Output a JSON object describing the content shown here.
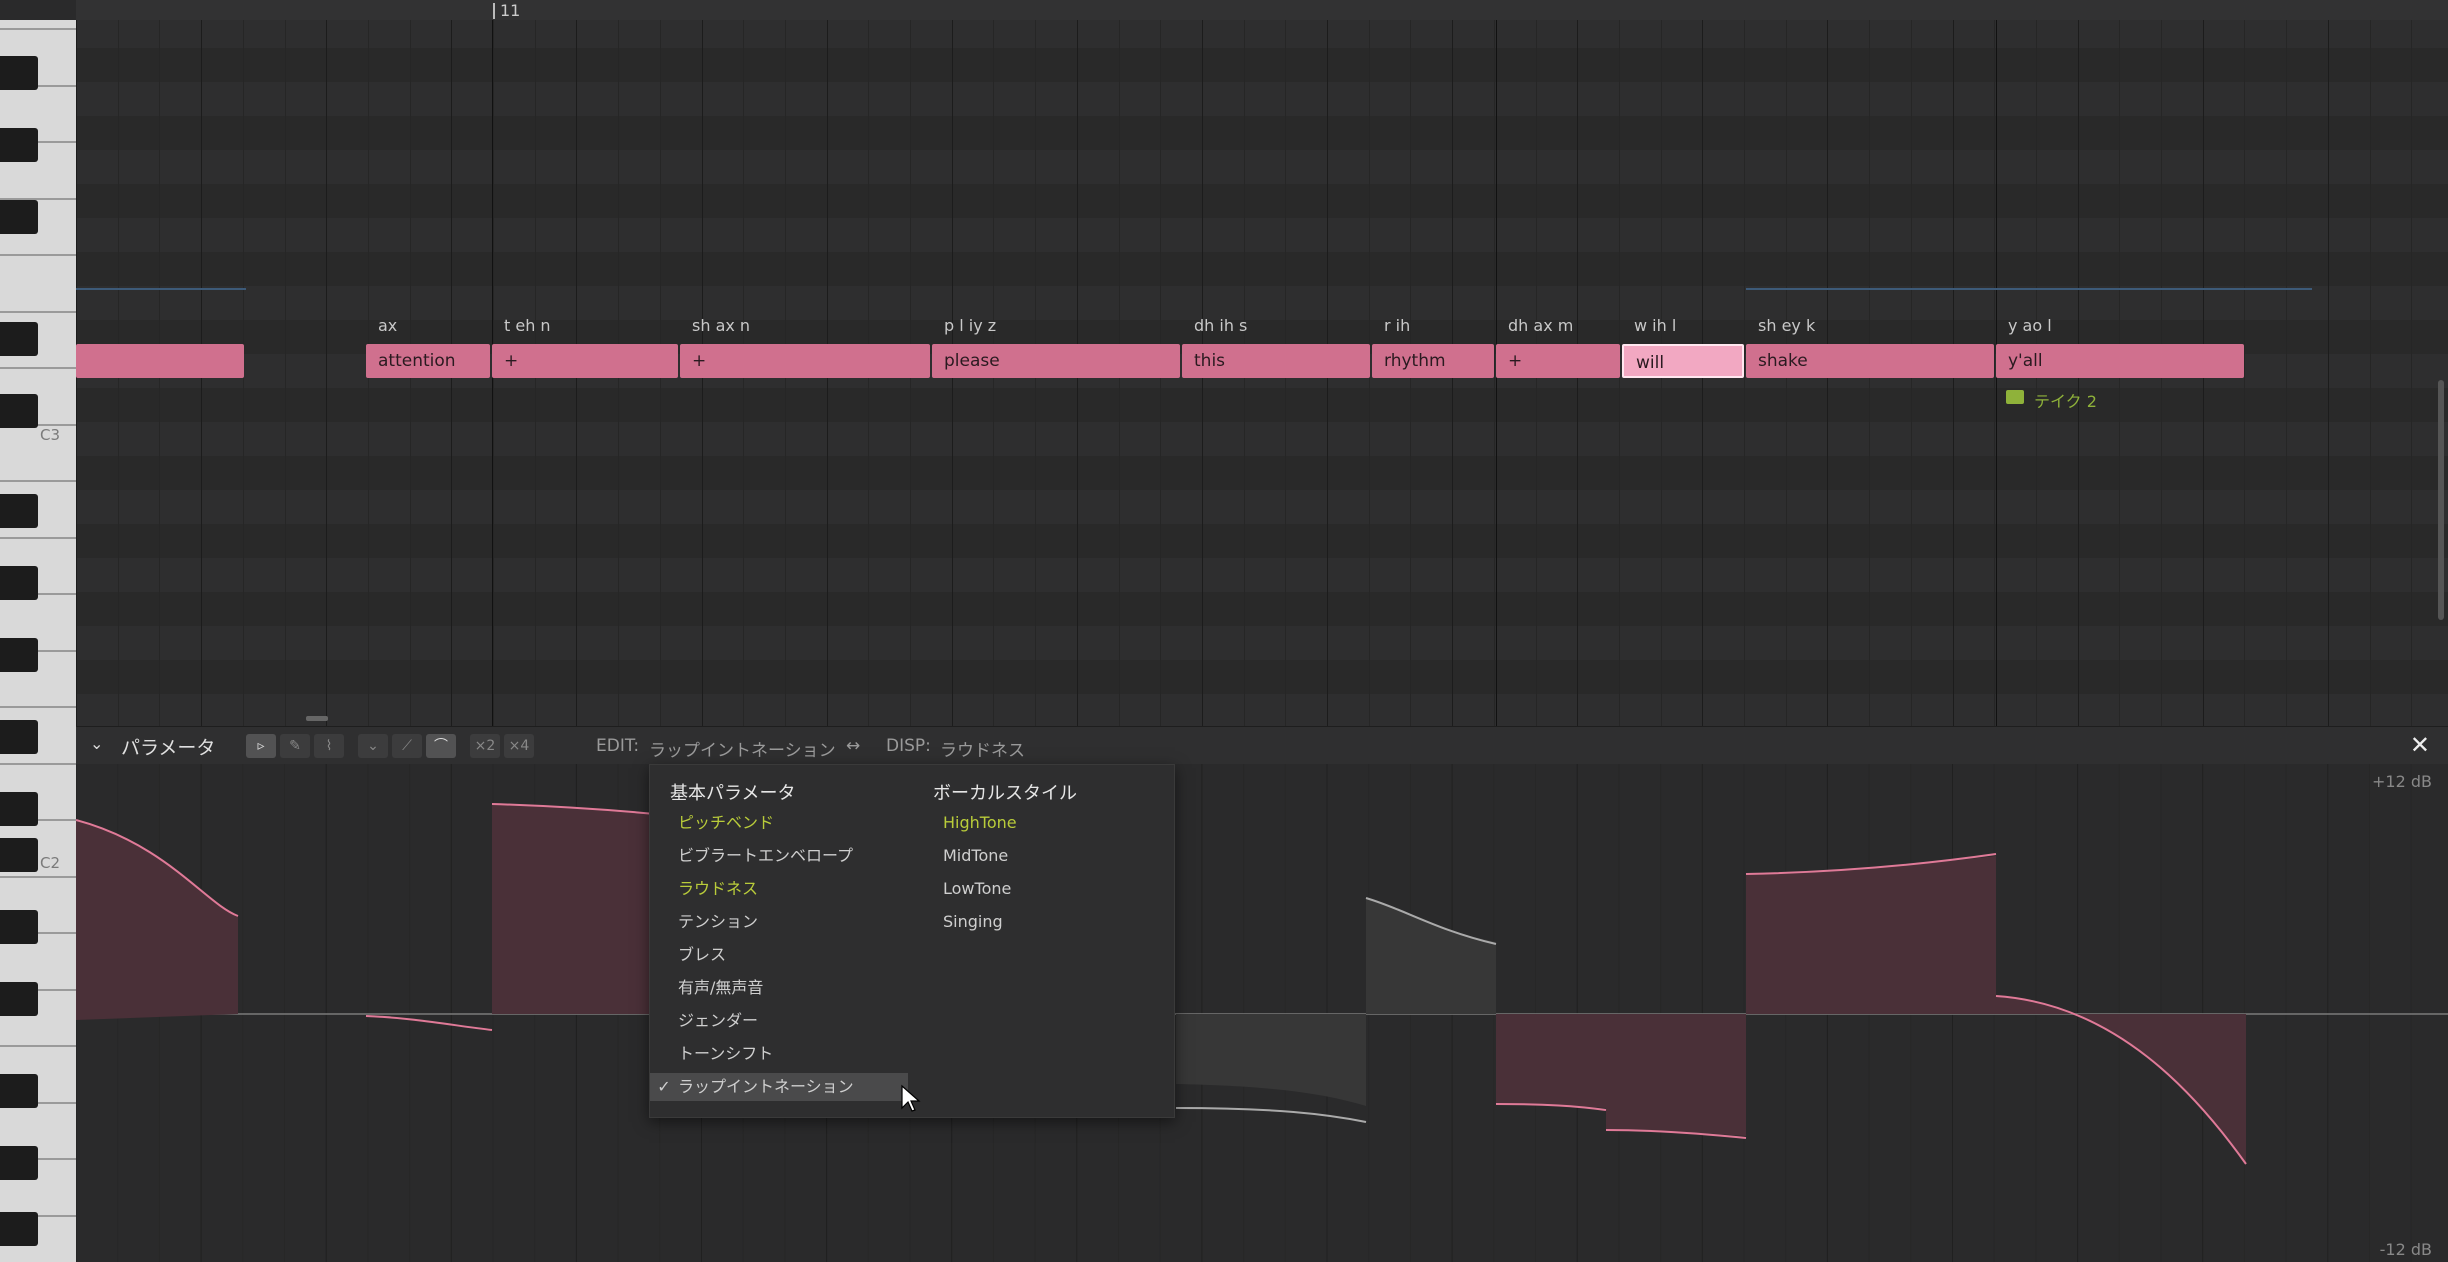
{
  "ruler": {
    "bar_number": "11"
  },
  "piano": {
    "label_c3": "C3",
    "label_c2": "C2"
  },
  "notes": [
    {
      "lyric": "",
      "phoneme": ""
    },
    {
      "lyric": "attention",
      "phoneme": "ax"
    },
    {
      "lyric": "+",
      "phoneme": "t eh n"
    },
    {
      "lyric": "+",
      "phoneme": "sh ax n"
    },
    {
      "lyric": "please",
      "phoneme": "p l iy z"
    },
    {
      "lyric": "this",
      "phoneme": "dh ih s"
    },
    {
      "lyric": "rhythm",
      "phoneme": "r ih"
    },
    {
      "lyric": "+",
      "phoneme": "dh ax m"
    },
    {
      "lyric": "will",
      "phoneme": "w ih l"
    },
    {
      "lyric": "shake",
      "phoneme": "sh ey k"
    },
    {
      "lyric": "y'all",
      "phoneme": "y ao l"
    }
  ],
  "take": {
    "label": "テイク 2"
  },
  "param_panel": {
    "title": "パラメータ",
    "edit_label": "EDIT:",
    "edit_value": "ラップイントネーション",
    "disp_label": "DISP:",
    "disp_value": "ラウドネス",
    "x2": "×2",
    "x4": "×4",
    "db_top": "+12 dB",
    "db_bottom": "-12 dB"
  },
  "menu": {
    "basic_header": "基本パラメータ",
    "vocal_header": "ボーカルスタイル",
    "basic_items": [
      {
        "label": "ピッチベンド",
        "highlight": true
      },
      {
        "label": "ビブラートエンベロープ",
        "highlight": false
      },
      {
        "label": "ラウドネス",
        "highlight": true
      },
      {
        "label": "テンション",
        "highlight": false
      },
      {
        "label": "ブレス",
        "highlight": false
      },
      {
        "label": "有声/無声音",
        "highlight": false
      },
      {
        "label": "ジェンダー",
        "highlight": false
      },
      {
        "label": "トーンシフト",
        "highlight": false
      },
      {
        "label": "ラップイントネーション",
        "highlight": false,
        "checked": true
      }
    ],
    "vocal_items": [
      {
        "label": "HighTone",
        "highlight": true
      },
      {
        "label": "MidTone",
        "highlight": false
      },
      {
        "label": "LowTone",
        "highlight": false
      },
      {
        "label": "Singing",
        "highlight": false
      }
    ],
    "check_mark": "✓"
  },
  "colors": {
    "note": "#d0708e",
    "note_selected": "#f2a8c2",
    "highlight": "#b9cc3a",
    "take": "#8fb23a"
  }
}
